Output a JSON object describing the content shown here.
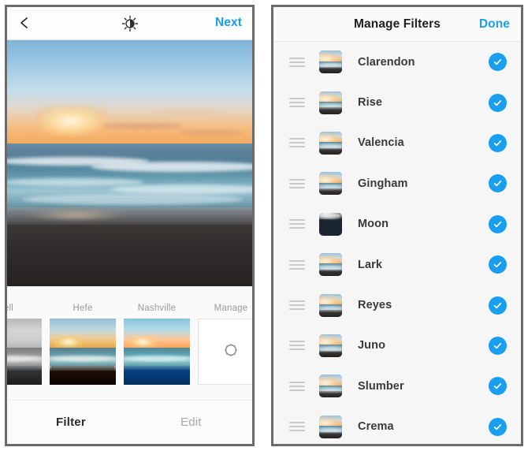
{
  "colors": {
    "accent_blue": "#1a9ef0",
    "panel_border": "#6b6b6b",
    "list_background": "#f6f6f6",
    "inactive_text": "#a8a8a8",
    "filter_label": "#9a9a9a"
  },
  "editor_panel": {
    "topbar": {
      "back_icon": "chevron-left-icon",
      "brightness_icon": "brightness-sun-icon",
      "next_label": "Next"
    },
    "photo": {
      "description": "beach sunset with waves and dark sand"
    },
    "filter_carousel": {
      "items": [
        {
          "label": "Inkwell",
          "label_visible": "ell",
          "style": "mono",
          "selected": false
        },
        {
          "label": "Hefe",
          "label_visible": "Hefe",
          "style": "warm",
          "selected": true
        },
        {
          "label": "Nashville",
          "label_visible": "Nashville",
          "style": "cool",
          "selected": false
        }
      ],
      "manage": {
        "label": "Manage",
        "icon": "gear-icon"
      }
    },
    "tabs": [
      {
        "label": "Filter",
        "active": true
      },
      {
        "label": "Edit",
        "active": false
      }
    ]
  },
  "manage_panel": {
    "header": {
      "title": "Manage Filters",
      "done_label": "Done"
    },
    "rows": [
      {
        "name": "Clarendon",
        "enabled": true,
        "thumb": "color"
      },
      {
        "name": "Rise",
        "enabled": true,
        "thumb": "color"
      },
      {
        "name": "Valencia",
        "enabled": true,
        "thumb": "color"
      },
      {
        "name": "Gingham",
        "enabled": true,
        "thumb": "color"
      },
      {
        "name": "Moon",
        "enabled": true,
        "thumb": "mono"
      },
      {
        "name": "Lark",
        "enabled": true,
        "thumb": "color"
      },
      {
        "name": "Reyes",
        "enabled": true,
        "thumb": "color"
      },
      {
        "name": "Juno",
        "enabled": true,
        "thumb": "color"
      },
      {
        "name": "Slumber",
        "enabled": true,
        "thumb": "color"
      },
      {
        "name": "Crema",
        "enabled": true,
        "thumb": "color"
      }
    ]
  }
}
